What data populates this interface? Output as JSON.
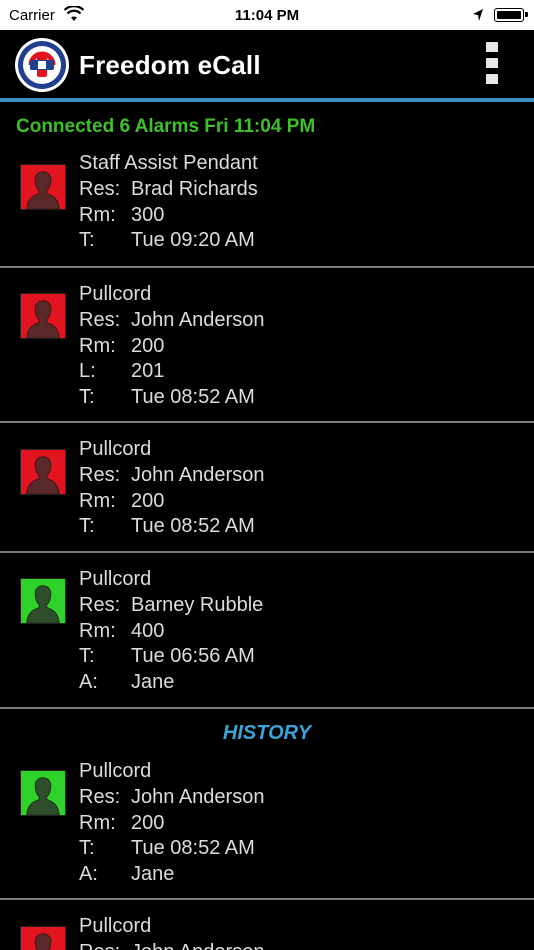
{
  "status_bar": {
    "carrier": "Carrier",
    "time": "11:04 PM",
    "icons": [
      "wifi-icon",
      "location-arrow-icon",
      "battery-icon"
    ]
  },
  "app_bar": {
    "title": "Freedom eCall",
    "logo_icon": "freedom-ecall-logo",
    "menu_icon": "vertical-dots-menu-icon",
    "accent_color": "#3d8fc0"
  },
  "connection_status": "Connected 6 Alarms Fri 11:04 PM",
  "alarms": [
    {
      "status": "red",
      "type": "Staff Assist Pendant",
      "fields": [
        {
          "key": "Res:",
          "value": "Brad Richards"
        },
        {
          "key": "Rm:",
          "value": "300"
        },
        {
          "key": "T:",
          "value": "Tue 09:20 AM"
        }
      ]
    },
    {
      "status": "red",
      "type": "Pullcord",
      "fields": [
        {
          "key": "Res:",
          "value": "John Anderson"
        },
        {
          "key": "Rm:",
          "value": "200"
        },
        {
          "key": "L:",
          "value": "201"
        },
        {
          "key": "T:",
          "value": "Tue 08:52 AM"
        }
      ]
    },
    {
      "status": "red",
      "type": "Pullcord",
      "fields": [
        {
          "key": "Res:",
          "value": "John Anderson"
        },
        {
          "key": "Rm:",
          "value": "200"
        },
        {
          "key": "T:",
          "value": "Tue 08:52 AM"
        }
      ]
    },
    {
      "status": "green",
      "type": "Pullcord",
      "fields": [
        {
          "key": "Res:",
          "value": "Barney Rubble"
        },
        {
          "key": "Rm:",
          "value": "400"
        },
        {
          "key": "T:",
          "value": "Tue 06:56 AM"
        },
        {
          "key": "A:",
          "value": "Jane"
        }
      ]
    }
  ],
  "history_label": "HISTORY",
  "history": [
    {
      "status": "green",
      "type": "Pullcord",
      "fields": [
        {
          "key": "Res:",
          "value": "John Anderson"
        },
        {
          "key": "Rm:",
          "value": "200"
        },
        {
          "key": "T:",
          "value": "Tue 08:52 AM"
        },
        {
          "key": "A:",
          "value": "Jane"
        }
      ]
    },
    {
      "status": "red",
      "type": "Pullcord",
      "fields": [
        {
          "key": "Res:",
          "value": "John Anderson"
        }
      ]
    }
  ],
  "colors": {
    "alarm_red": "#e1141f",
    "acknowledged_green": "#2fd22b",
    "connected_text": "#3fbf2a",
    "history_text": "#3da3d6"
  }
}
